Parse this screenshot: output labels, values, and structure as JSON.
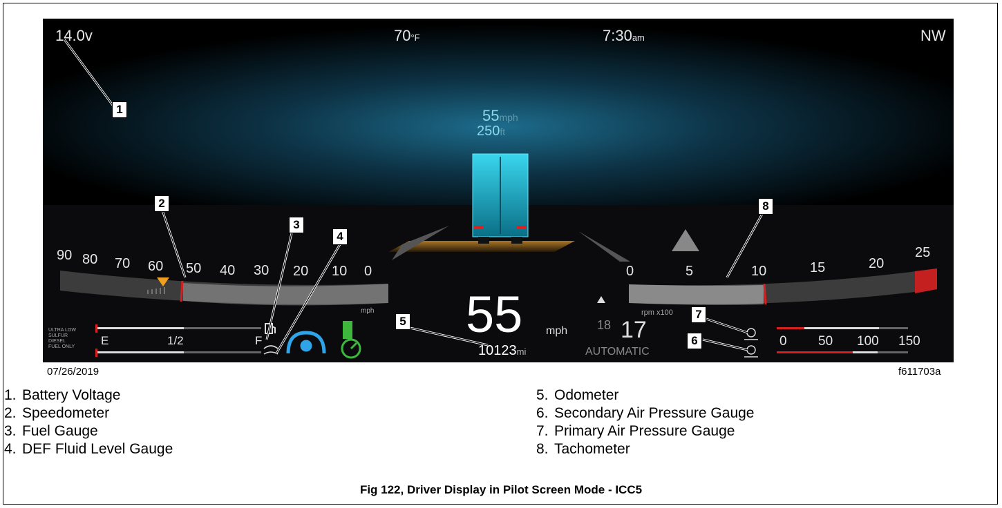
{
  "display": {
    "voltage": "14.0v",
    "temperature": "70°F",
    "temperature_value": "70",
    "temperature_unit": "°F",
    "time_value": "7:30",
    "time_suffix": "am",
    "heading": "NW",
    "lead_speed_value": "55",
    "lead_speed_unit": "mph",
    "lead_distance_value": "250",
    "lead_distance_unit": "ft",
    "speed_value": "55",
    "speed_unit": "mph",
    "odometer_value": "10123",
    "odometer_unit": "mi",
    "speedometer_ticks": [
      "90",
      "80",
      "70",
      "60",
      "50",
      "40",
      "30",
      "20",
      "10",
      "0"
    ],
    "speedometer_unit": "mph",
    "tach_ticks": [
      "0",
      "5",
      "10",
      "15",
      "20",
      "25"
    ],
    "tach_unit": "rpm x100",
    "gear_target": "18",
    "gear_current": "17",
    "transmission_mode": "AUTOMATIC",
    "fuel_notice": [
      "ULTRA LOW",
      "SULFUR",
      "DIESEL",
      "FUEL ONLY"
    ],
    "fuel_empty": "E",
    "fuel_half": "1/2",
    "fuel_full": "F",
    "air_ticks": [
      "0",
      "50",
      "100",
      "150"
    ],
    "colors": {
      "accent": "#2fa4e7",
      "green": "#3db83d",
      "red": "#d81e1e",
      "orange": "#f0a020"
    }
  },
  "callouts": [
    "1",
    "2",
    "3",
    "4",
    "5",
    "6",
    "7",
    "8"
  ],
  "date_stamp": "07/26/2019",
  "figure_id": "f611703a",
  "legend_left": [
    {
      "n": "1.",
      "label": "Battery Voltage"
    },
    {
      "n": "2.",
      "label": "Speedometer"
    },
    {
      "n": "3.",
      "label": "Fuel Gauge"
    },
    {
      "n": "4.",
      "label": "DEF Fluid Level Gauge"
    }
  ],
  "legend_right": [
    {
      "n": "5.",
      "label": "Odometer"
    },
    {
      "n": "6.",
      "label": "Secondary Air Pressure Gauge"
    },
    {
      "n": "7.",
      "label": "Primary Air Pressure Gauge"
    },
    {
      "n": "8.",
      "label": "Tachometer"
    }
  ],
  "caption": "Fig 122, Driver Display in Pilot Screen Mode - ICC5"
}
